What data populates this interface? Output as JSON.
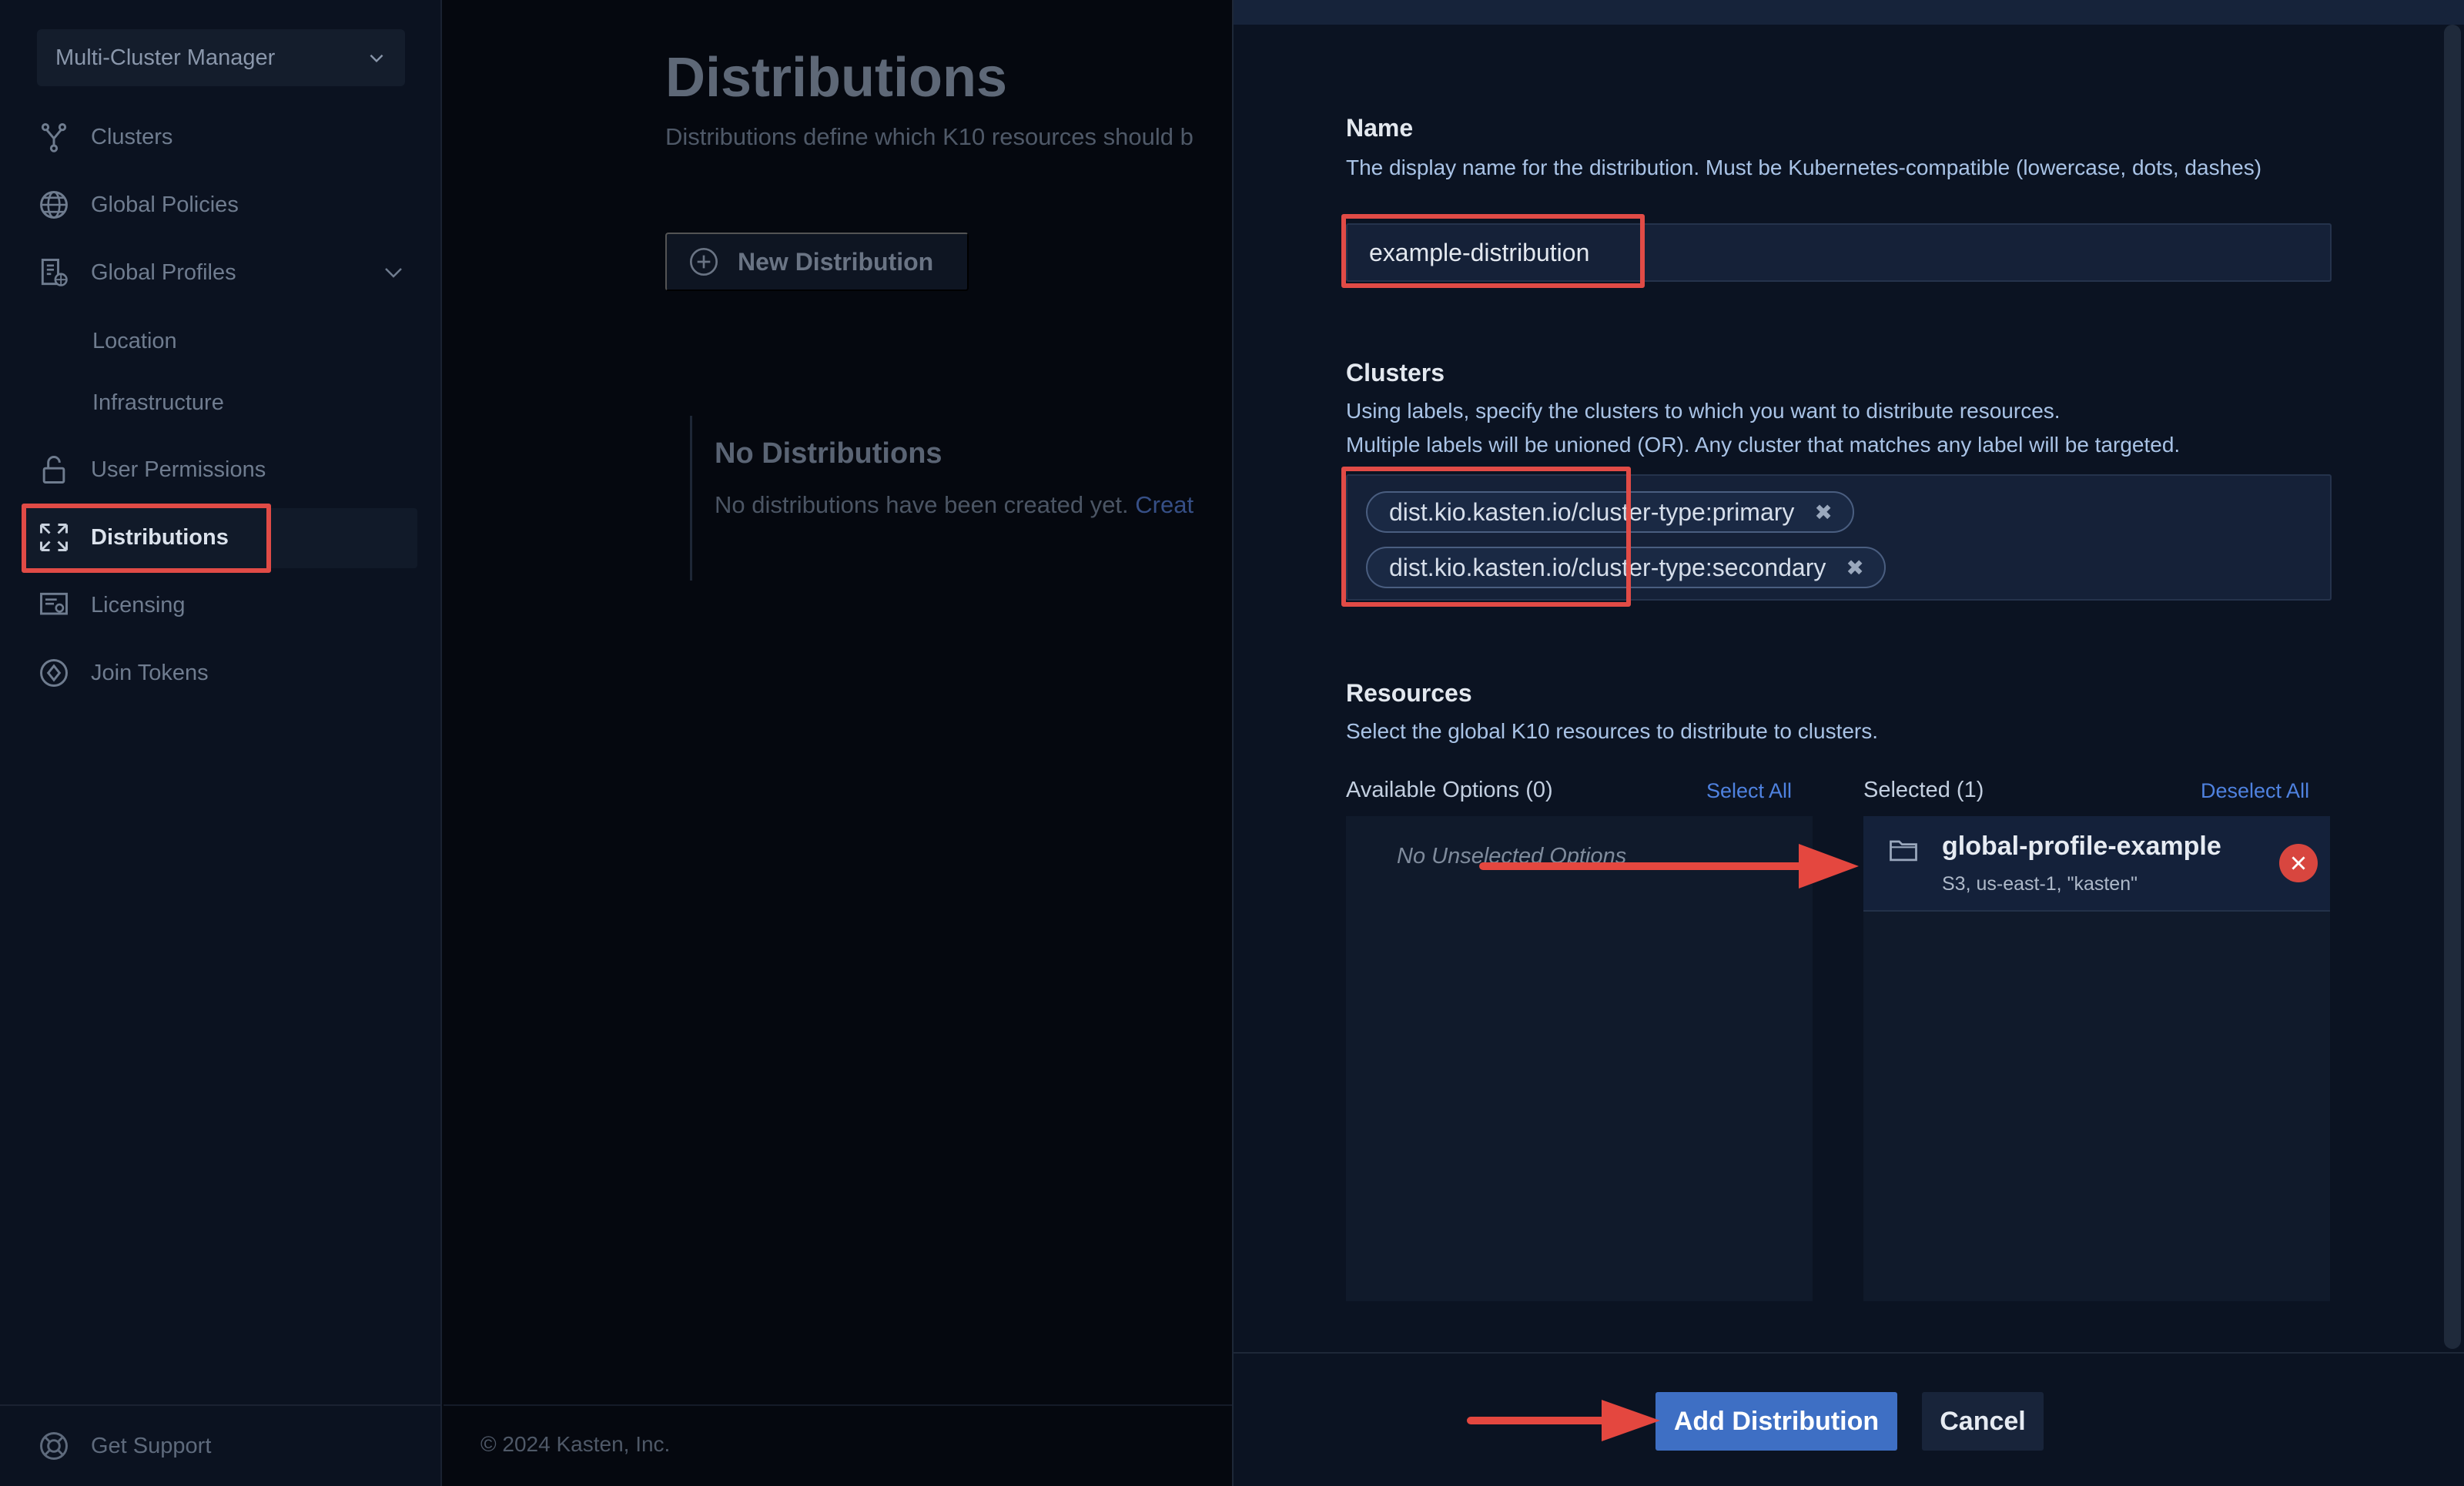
{
  "sidebar": {
    "cluster_selector": "Multi-Cluster Manager",
    "items": [
      {
        "label": "Clusters",
        "icon": "clusters-icon"
      },
      {
        "label": "Global Policies",
        "icon": "globe-icon"
      },
      {
        "label": "Global Profiles",
        "icon": "profiles-icon"
      },
      {
        "label": "User Permissions",
        "icon": "lock-icon"
      },
      {
        "label": "Distributions",
        "icon": "distributions-icon"
      },
      {
        "label": "Licensing",
        "icon": "license-icon"
      },
      {
        "label": "Join Tokens",
        "icon": "token-icon"
      }
    ],
    "subitems": [
      "Location",
      "Infrastructure"
    ],
    "support_label": "Get Support"
  },
  "main": {
    "title": "Distributions",
    "description": "Distributions define which K10 resources should b",
    "new_button": "New Distribution",
    "empty_title": "No Distributions",
    "empty_text": "No distributions have been created yet.",
    "empty_link": "Creat",
    "copyright": "© 2024 Kasten, Inc."
  },
  "form": {
    "name": {
      "label": "Name",
      "help": "The display name for the distribution. Must be Kubernetes-compatible (lowercase, dots, dashes)",
      "value": "example-distribution"
    },
    "clusters": {
      "label": "Clusters",
      "help_line1": "Using labels, specify the clusters to which you want to distribute resources.",
      "help_line2": "Multiple labels will be unioned (OR). Any cluster that matches any label will be targeted.",
      "tags": [
        "dist.kio.kasten.io/cluster-type:primary",
        "dist.kio.kasten.io/cluster-type:secondary"
      ],
      "tag_remove_glyph": "✖"
    },
    "resources": {
      "label": "Resources",
      "help": "Select the global K10 resources to distribute to clusters.",
      "available_header": "Available Options (0)",
      "select_all": "Select All",
      "no_options": "No Unselected Options",
      "selected_header": "Selected (1)",
      "deselect_all": "Deselect All",
      "selected_items": [
        {
          "title": "global-profile-example",
          "subtitle": "S3, us-east-1, \"kasten\""
        }
      ]
    },
    "submit_label": "Add Distribution",
    "cancel_label": "Cancel"
  },
  "colors": {
    "accent": "#3e6fc4",
    "highlight": "#e14b46",
    "link": "#4f82e0"
  }
}
